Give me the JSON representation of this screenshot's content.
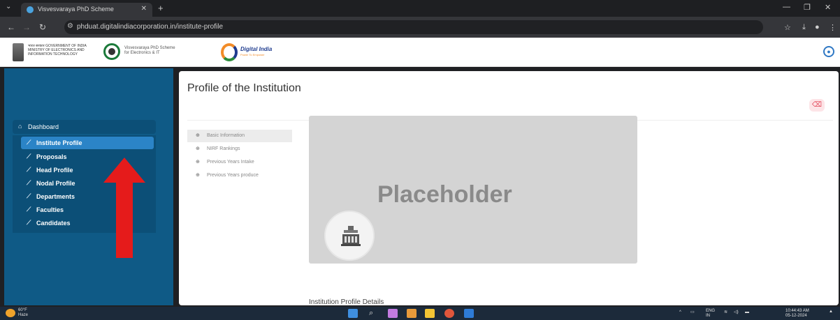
{
  "browser": {
    "tab_title": "Visvesvaraya PhD Scheme",
    "url": "phduat.digitalindiacorporation.in/institute-profile",
    "new_tab": "+",
    "close": "✕"
  },
  "header": {
    "meity_text": "भारत सरकार GOVERNMENT OF INDIA MINISTRY OF ELECTRONICS AND INFORMATION TECHNOLOGY",
    "vv_text_line1": "Visvesvaraya PhD Scheme",
    "vv_text_line2": "for Electronics & IT",
    "di_text": "Digital India",
    "di_sub": "Power To Empower"
  },
  "sidebar": {
    "dashboard": "Dashboard",
    "items": [
      {
        "label": "Institute Profile",
        "active": true
      },
      {
        "label": "Proposals"
      },
      {
        "label": "Head Profile"
      },
      {
        "label": "Nodal Profile"
      },
      {
        "label": "Departments"
      },
      {
        "label": "Faculties"
      },
      {
        "label": "Candidates"
      }
    ]
  },
  "main": {
    "title": "Profile of the Institution",
    "profile_menu": [
      {
        "label": "Basic Information",
        "active": true
      },
      {
        "label": "NIRF Rankings"
      },
      {
        "label": "Previous Years Intake"
      },
      {
        "label": "Previous Years produce"
      }
    ],
    "placeholder_text": "Placeholder",
    "details_title": "Institution Profile Details"
  },
  "taskbar": {
    "temp": "60°F",
    "weather": "Haze",
    "lang1": "ENG",
    "lang2": "IN",
    "time": "10:44:43 AM",
    "date": "05-12-2024"
  },
  "colors": {
    "sidebar_bg": "#0f5a86",
    "active_item": "#2b84c7",
    "arrow": "#e51b1b",
    "placeholder_bg": "#d4d4d4"
  }
}
